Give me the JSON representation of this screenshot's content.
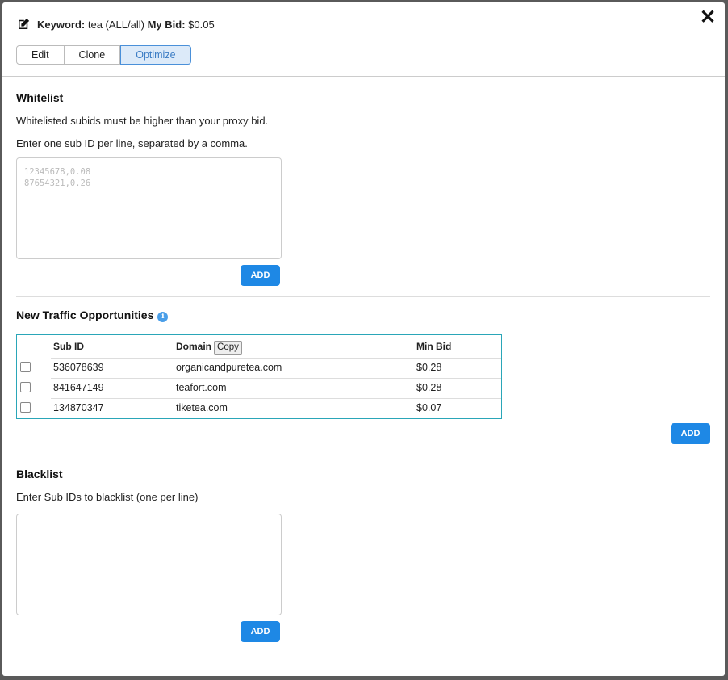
{
  "header": {
    "keyword_label": "Keyword:",
    "keyword_value": "tea (ALL/all)",
    "bid_label": "My Bid:",
    "bid_value": "$0.05",
    "tabs": [
      {
        "label": "Edit"
      },
      {
        "label": "Clone"
      },
      {
        "label": "Optimize"
      }
    ],
    "active_tab": "Optimize",
    "close": "✕"
  },
  "whitelist": {
    "title": "Whitelist",
    "desc1": "Whitelisted subids must be higher than your proxy bid.",
    "desc2": "Enter one sub ID per line, separated by a comma.",
    "placeholder": "12345678,0.08\n87654321,0.26",
    "add_label": "ADD"
  },
  "traffic": {
    "title": "New Traffic Opportunities",
    "info_icon": "info-icon",
    "columns": {
      "subid": "Sub ID",
      "domain": "Domain",
      "copy": "Copy",
      "minbid": "Min Bid"
    },
    "rows": [
      {
        "subid": "536078639",
        "domain": "organicandpuretea.com",
        "minbid": "$0.28",
        "checked": false
      },
      {
        "subid": "841647149",
        "domain": "teafort.com",
        "minbid": "$0.28",
        "checked": false
      },
      {
        "subid": "134870347",
        "domain": "tiketea.com",
        "minbid": "$0.07",
        "checked": false
      }
    ],
    "add_label": "ADD"
  },
  "blacklist": {
    "title": "Blacklist",
    "desc": "Enter Sub IDs to blacklist (one per line)",
    "placeholder": "",
    "add_label": "ADD"
  },
  "colors": {
    "accent": "#1e88e5",
    "table_border": "#2aa6b8",
    "active_tab_bg": "#dceaf9"
  }
}
